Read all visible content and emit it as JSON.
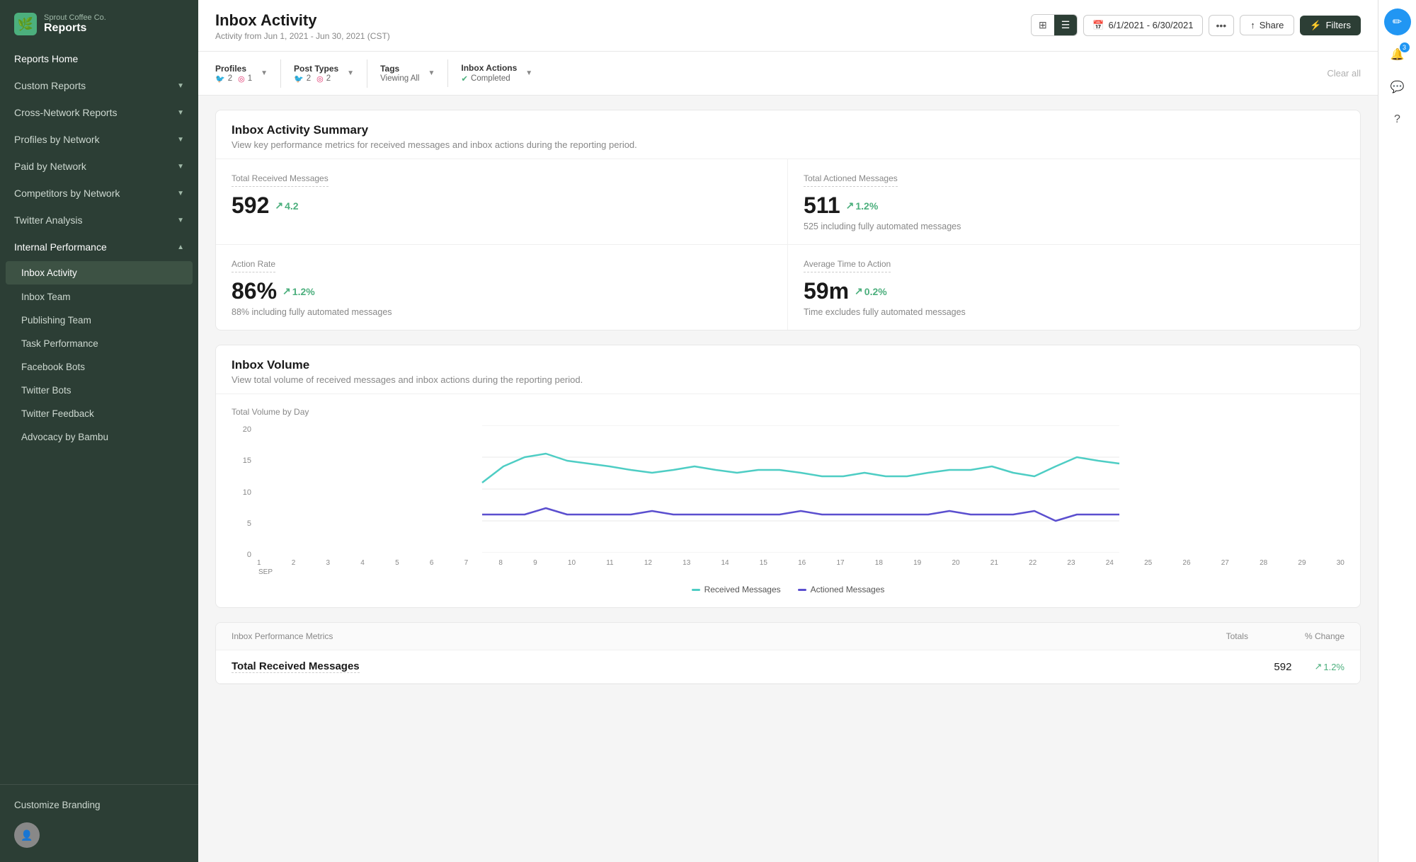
{
  "brand": {
    "company": "Sprout Coffee Co.",
    "title": "Reports"
  },
  "sidebar": {
    "nav_items": [
      {
        "id": "reports-home",
        "label": "Reports Home",
        "has_chevron": false
      },
      {
        "id": "custom-reports",
        "label": "Custom Reports",
        "has_chevron": true
      },
      {
        "id": "cross-network",
        "label": "Cross-Network Reports",
        "has_chevron": true
      },
      {
        "id": "profiles-by-network",
        "label": "Profiles by Network",
        "has_chevron": true
      },
      {
        "id": "paid-by-network",
        "label": "Paid by Network",
        "has_chevron": true
      },
      {
        "id": "competitors-by-network",
        "label": "Competitors by Network",
        "has_chevron": true
      },
      {
        "id": "twitter-analysis",
        "label": "Twitter Analysis",
        "has_chevron": true
      },
      {
        "id": "internal-performance",
        "label": "Internal Performance",
        "has_chevron": true,
        "expanded": true
      }
    ],
    "sub_items": [
      {
        "id": "inbox-activity",
        "label": "Inbox Activity",
        "active": true
      },
      {
        "id": "inbox-team",
        "label": "Inbox Team"
      },
      {
        "id": "publishing-team",
        "label": "Publishing Team"
      },
      {
        "id": "task-performance",
        "label": "Task Performance"
      },
      {
        "id": "facebook-bots",
        "label": "Facebook Bots"
      },
      {
        "id": "twitter-bots",
        "label": "Twitter Bots"
      },
      {
        "id": "twitter-feedback",
        "label": "Twitter Feedback"
      },
      {
        "id": "advocacy-by-bambu",
        "label": "Advocacy by Bambu"
      }
    ],
    "bottom": {
      "customize": "Customize Branding"
    }
  },
  "header": {
    "title": "Inbox Activity",
    "subtitle": "Activity from Jun 1, 2021 - Jun 30, 2021 (CST)",
    "date_range": "6/1/2021 - 6/30/2021",
    "share_label": "Share",
    "filters_label": "Filters"
  },
  "filters": {
    "profiles": {
      "label": "Profiles",
      "twitter_count": "2",
      "instagram_count": "1"
    },
    "post_types": {
      "label": "Post Types",
      "twitter_count": "2",
      "instagram_count": "2"
    },
    "tags": {
      "label": "Tags",
      "value": "Viewing All"
    },
    "inbox_actions": {
      "label": "Inbox Actions",
      "value": "Completed"
    },
    "clear_all": "Clear all"
  },
  "summary_card": {
    "title": "Inbox Activity Summary",
    "description": "View key performance metrics for received messages and inbox actions during the reporting period.",
    "metrics": [
      {
        "name": "Total Received Messages",
        "value": "592",
        "change": "4.2",
        "sub": ""
      },
      {
        "name": "Total Actioned Messages",
        "value": "511",
        "change": "1.2%",
        "sub": "525 including fully automated messages"
      },
      {
        "name": "Action Rate",
        "value": "86%",
        "change": "1.2%",
        "sub": "88% including fully automated messages"
      },
      {
        "name": "Average Time to Action",
        "value": "59m",
        "change": "0.2%",
        "sub": "Time excludes fully automated messages"
      }
    ]
  },
  "volume_card": {
    "title": "Inbox Volume",
    "description": "View total volume of received messages and inbox actions during the reporting period.",
    "chart_label": "Total Volume by Day",
    "y_labels": [
      "20",
      "15",
      "10",
      "5",
      "0"
    ],
    "x_labels": [
      "1",
      "2",
      "3",
      "4",
      "5",
      "6",
      "7",
      "8",
      "9",
      "10",
      "11",
      "12",
      "13",
      "14",
      "15",
      "16",
      "17",
      "18",
      "19",
      "20",
      "21",
      "22",
      "23",
      "24",
      "25",
      "26",
      "27",
      "28",
      "29",
      "30"
    ],
    "x_sub": "SEP",
    "legend": [
      {
        "label": "Received Messages",
        "type": "received"
      },
      {
        "label": "Actioned Messages",
        "type": "actioned"
      }
    ]
  },
  "perf_table": {
    "header_metric": "Inbox Performance Metrics",
    "header_totals": "Totals",
    "header_change": "% Change",
    "rows": [
      {
        "name": "Total Received Messages",
        "total": "592",
        "change": "1.2%"
      }
    ]
  }
}
